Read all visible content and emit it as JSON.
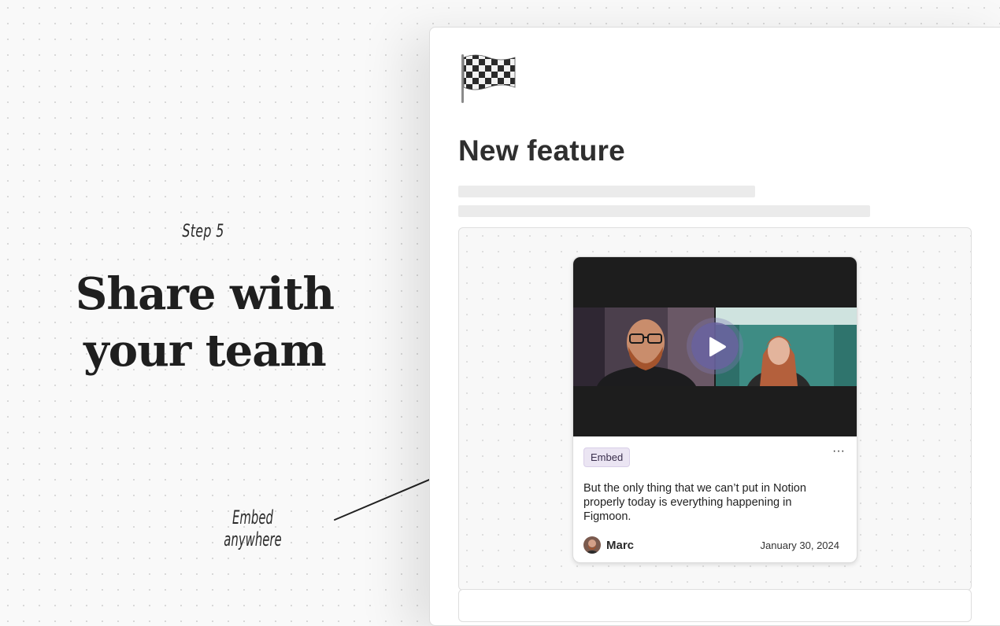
{
  "hero": {
    "step_label": "Step 5",
    "headline_line1": "Share with",
    "headline_line2": "your team",
    "annotation": "Embed anywhere"
  },
  "page": {
    "icon": "checkered-flag-icon",
    "title": "New feature"
  },
  "embed_card": {
    "badge": "Embed",
    "more_label": "···",
    "description": "But the only thing that we can’t put in Notion properly today is everything happening in Figmoon.",
    "author": "Marc",
    "date": "January 30, 2024"
  },
  "colors": {
    "play_button": "#6a64a0",
    "badge_background": "#ebe5f3",
    "video_background": "#1d1d1d"
  }
}
